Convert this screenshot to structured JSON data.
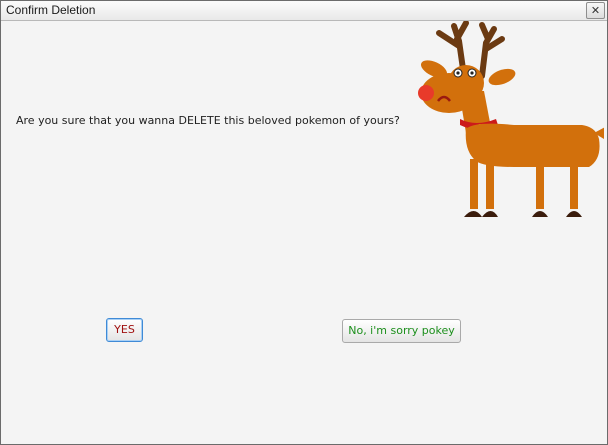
{
  "window": {
    "title": "Confirm Deletion",
    "close_label": "✕"
  },
  "dialog": {
    "question": "Are you sure that you wanna DELETE this beloved pokemon of yours?",
    "yes_label": "YES",
    "no_label": "No, i'm sorry pokey"
  },
  "colors": {
    "yes_text": "#a01010",
    "no_text": "#1c8f1c",
    "reindeer_body": "#d2700c",
    "antler": "#6b3a12",
    "collar": "#cc1a1a"
  },
  "image": {
    "subject": "reindeer-drawing"
  }
}
